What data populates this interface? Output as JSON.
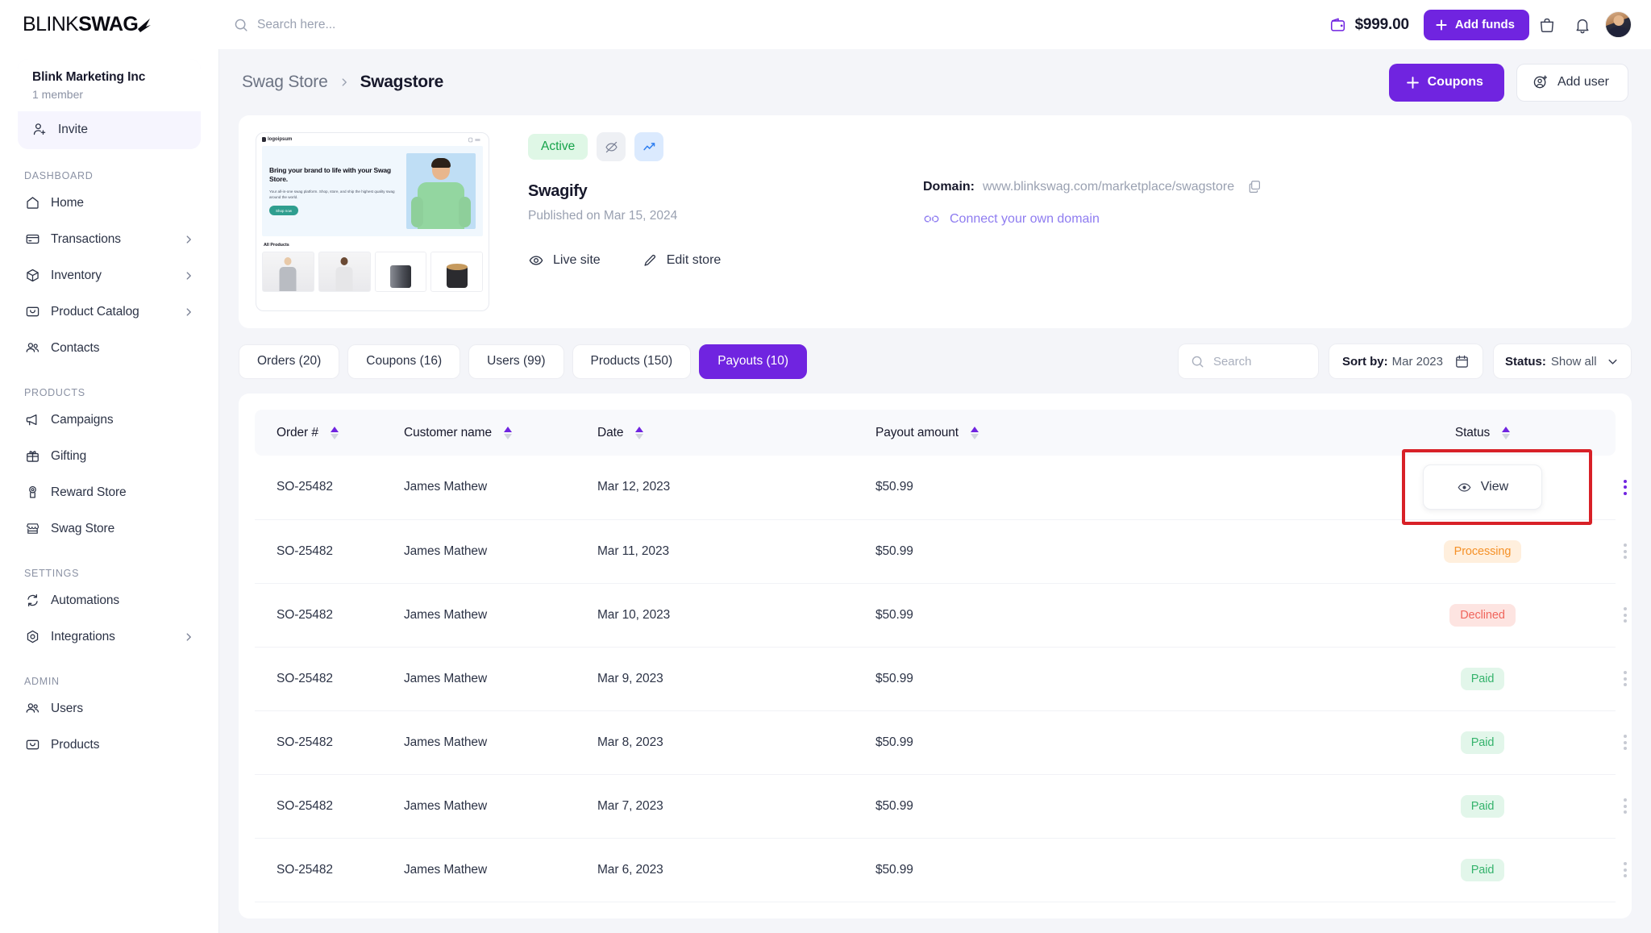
{
  "topbar": {
    "logo_part1": "BLINK",
    "logo_part2": "SWAG",
    "search_placeholder": "Search here...",
    "search_value": "",
    "wallet_amount": "$999.00",
    "add_funds_label": "Add funds",
    "icons": [
      "wallet-icon",
      "plus-icon",
      "bag-icon",
      "bell-icon",
      "avatar"
    ]
  },
  "sidebar": {
    "org_name": "Blink Marketing Inc",
    "org_members": "1 member",
    "invite_label": "Invite",
    "sections": [
      {
        "label": "DASHBOARD",
        "items": [
          {
            "label": "Home",
            "icon": "home-icon",
            "chevron": false
          },
          {
            "label": "Transactions",
            "icon": "card-icon",
            "chevron": true
          },
          {
            "label": "Inventory",
            "icon": "box-icon",
            "chevron": true
          },
          {
            "label": "Product Catalog",
            "icon": "catalog-icon",
            "chevron": true
          },
          {
            "label": "Contacts",
            "icon": "people-icon",
            "chevron": false
          }
        ]
      },
      {
        "label": "PRODUCTS",
        "items": [
          {
            "label": "Campaigns",
            "icon": "megaphone-icon",
            "chevron": false
          },
          {
            "label": "Gifting",
            "icon": "gift-icon",
            "chevron": false
          },
          {
            "label": "Reward Store",
            "icon": "medal-icon",
            "chevron": false
          },
          {
            "label": "Swag Store",
            "icon": "storefront-icon",
            "chevron": false
          }
        ]
      },
      {
        "label": "SETTINGS",
        "items": [
          {
            "label": "Automations",
            "icon": "refresh-icon",
            "chevron": false
          },
          {
            "label": "Integrations",
            "icon": "hexagon-icon",
            "chevron": true
          }
        ]
      },
      {
        "label": "ADMIN",
        "items": [
          {
            "label": "Users",
            "icon": "people-icon",
            "chevron": false
          },
          {
            "label": "Products",
            "icon": "catalog-icon",
            "chevron": false
          }
        ]
      }
    ]
  },
  "header": {
    "breadcrumb_parent": "Swag Store",
    "breadcrumb_current": "Swagstore",
    "coupons_label": "Coupons",
    "add_user_label": "Add user"
  },
  "store": {
    "status_badge": "Active",
    "name": "Swagify",
    "published": "Published on Mar 15, 2024",
    "live_site_label": "Live site",
    "edit_store_label": "Edit store",
    "domain_label": "Domain:",
    "domain_url": "www.blinkswag.com/marketplace/swagstore",
    "connect_domain_label": "Connect your own domain",
    "preview": {
      "logo_text": "logoipsum",
      "hero_heading": "Bring your brand to life with your Swag Store.",
      "hero_body": "Your all-in-one swag platform. Shop, store, and ship the highest quality swag around the world.",
      "hero_button": "Shop now",
      "section_title": "All Products"
    }
  },
  "tabs": [
    {
      "label": "Orders (20)",
      "active": false
    },
    {
      "label": "Coupons (16)",
      "active": false
    },
    {
      "label": "Users (99)",
      "active": false
    },
    {
      "label": "Products (150)",
      "active": false
    },
    {
      "label": "Payouts (10)",
      "active": true
    }
  ],
  "filters": {
    "search_placeholder": "Search",
    "search_value": "",
    "sort_label": "Sort by:",
    "sort_value": "Mar 2023",
    "status_label": "Status:",
    "status_value": "Show all"
  },
  "table": {
    "columns": [
      {
        "label": "Order #",
        "sortable": true
      },
      {
        "label": "Customer name",
        "sortable": true
      },
      {
        "label": "Date",
        "sortable": true
      },
      {
        "label": "Payout amount",
        "sortable": true
      },
      {
        "label": "Status",
        "sortable": true
      }
    ],
    "rows": [
      {
        "order": "SO-25482",
        "customer": "James Mathew",
        "date": "Mar 12, 2023",
        "amount": "$50.99",
        "status": "",
        "action": "View"
      },
      {
        "order": "SO-25482",
        "customer": "James Mathew",
        "date": "Mar 11, 2023",
        "amount": "$50.99",
        "status": "Processing",
        "action": ""
      },
      {
        "order": "SO-25482",
        "customer": "James Mathew",
        "date": "Mar 10, 2023",
        "amount": "$50.99",
        "status": "Declined",
        "action": ""
      },
      {
        "order": "SO-25482",
        "customer": "James Mathew",
        "date": "Mar 9, 2023",
        "amount": "$50.99",
        "status": "Paid",
        "action": ""
      },
      {
        "order": "SO-25482",
        "customer": "James Mathew",
        "date": "Mar 8, 2023",
        "amount": "$50.99",
        "status": "Paid",
        "action": ""
      },
      {
        "order": "SO-25482",
        "customer": "James Mathew",
        "date": "Mar 7, 2023",
        "amount": "$50.99",
        "status": "Paid",
        "action": ""
      },
      {
        "order": "SO-25482",
        "customer": "James Mathew",
        "date": "Mar 6, 2023",
        "amount": "$50.99",
        "status": "Paid",
        "action": ""
      }
    ]
  },
  "colors": {
    "accent": "#7024e0",
    "paid": "#35b36c",
    "processing": "#f59128",
    "declined": "#f0655c",
    "highlight_box": "#d82027"
  }
}
